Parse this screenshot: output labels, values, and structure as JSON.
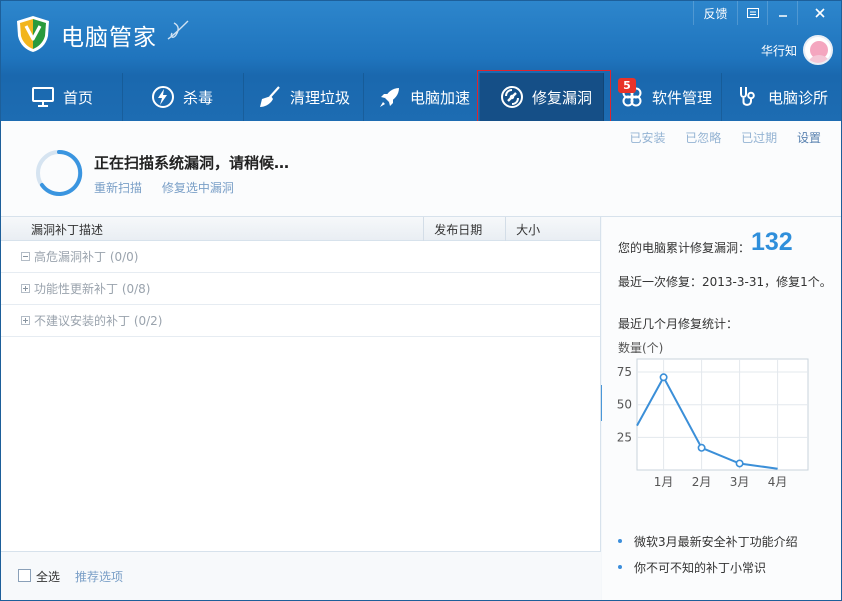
{
  "app": {
    "title": "电脑管家",
    "feedback": "反馈",
    "user_name": "华行知"
  },
  "nav": {
    "items": [
      {
        "label": "首页",
        "icon": "monitor-icon"
      },
      {
        "label": "杀毒",
        "icon": "lightning-icon"
      },
      {
        "label": "清理垃圾",
        "icon": "broom-icon"
      },
      {
        "label": "电脑加速",
        "icon": "rocket-icon"
      },
      {
        "label": "修复漏洞",
        "icon": "shield-icon",
        "active": true
      },
      {
        "label": "软件管理",
        "icon": "clover-icon",
        "badge": "5"
      },
      {
        "label": "电脑诊所",
        "icon": "stethoscope-icon"
      }
    ]
  },
  "scan": {
    "title": "正在扫描系统漏洞，请稍候…",
    "rescan": "重新扫描",
    "fix_selected": "修复选中漏洞"
  },
  "top_links": {
    "installed": "已安装",
    "ignored": "已忽略",
    "expired": "已过期",
    "settings": "设置"
  },
  "table": {
    "col_desc": "漏洞补丁描述",
    "col_date": "发布日期",
    "col_size": "大小",
    "groups": [
      {
        "label": "高危漏洞补丁 (0/0)",
        "expanded": true
      },
      {
        "label": "功能性更新补丁 (0/8)",
        "expanded": false
      },
      {
        "label": "不建议安装的补丁 (0/2)",
        "expanded": false
      }
    ]
  },
  "footer": {
    "select_all": "全选",
    "recommended": "推荐选项"
  },
  "stats": {
    "total_label": "您的电脑累计修复漏洞：",
    "total_value": "132",
    "last_fix": "最近一次修复：2013-3-31，修复1个。",
    "monthly_title": "最近几个月修复统计：",
    "y_label": "数量(个)"
  },
  "chart_data": {
    "type": "line",
    "categories": [
      "1月",
      "2月",
      "3月",
      "4月"
    ],
    "x": [
      0,
      1,
      2,
      3,
      4,
      5
    ],
    "xticks": [
      "1月",
      "2月",
      "3月",
      "4月"
    ],
    "values_full": [
      35,
      71,
      17,
      5,
      1
    ],
    "series": [
      {
        "points": [
          [
            0.3,
            34
          ],
          [
            1,
            71
          ],
          [
            2,
            17
          ],
          [
            3,
            5
          ],
          [
            4,
            1
          ]
        ]
      }
    ],
    "yticks": [
      25,
      50,
      75
    ],
    "ylim": [
      0,
      85
    ],
    "xlim": [
      0.3,
      4.8
    ],
    "grid": true
  },
  "news": [
    "微软3月最新安全补丁功能介绍",
    "你不可不知的补丁小常识"
  ],
  "colors": {
    "titlebar": "#1f74bd",
    "nav_active": "#154f87",
    "accent": "#2f8fdb",
    "highlight_box": "#e0242d",
    "badge": "#e8332a"
  }
}
